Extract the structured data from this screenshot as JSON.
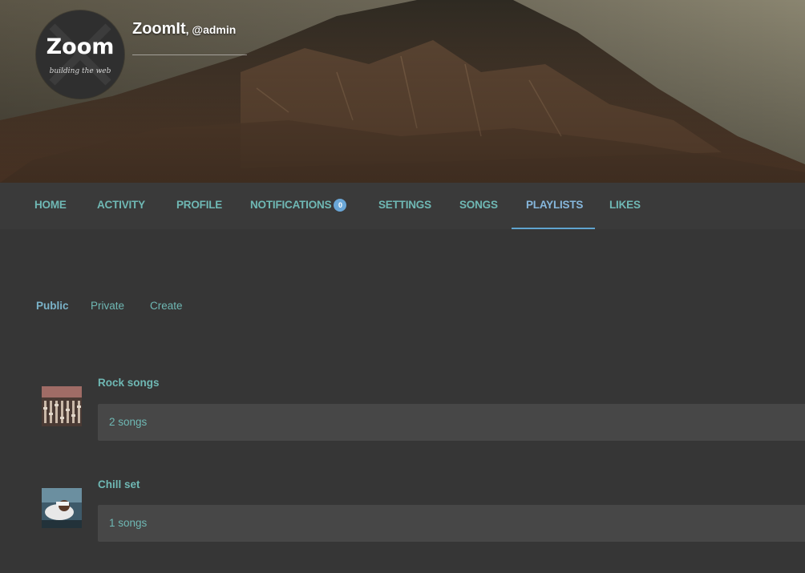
{
  "profile": {
    "display_name": "ZoomIt",
    "username": ", @admin",
    "avatar_logo": "Zoom",
    "avatar_tagline": "building the web"
  },
  "nav": {
    "items": [
      {
        "label": "HOME"
      },
      {
        "label": "ACTIVITY"
      },
      {
        "label": "PROFILE"
      },
      {
        "label": "NOTIFICATIONS",
        "badge": "0"
      },
      {
        "label": "SETTINGS"
      },
      {
        "label": "SONGS"
      },
      {
        "label": "PLAYLISTS",
        "active": true
      },
      {
        "label": "LIKES"
      }
    ]
  },
  "subtabs": [
    {
      "label": "Public",
      "active": true
    },
    {
      "label": "Private"
    },
    {
      "label": "Create"
    }
  ],
  "playlists": [
    {
      "title": "Rock songs",
      "count": "2 songs",
      "thumb_icon": "mixing-console-image"
    },
    {
      "title": "Chill set",
      "count": "1 songs",
      "thumb_icon": "person-relaxing-image"
    }
  ],
  "colors": {
    "link": "#6fb8b4",
    "active_link": "#86b7dc",
    "badge": "#6aa7d8",
    "background": "#363636",
    "bar": "#474747"
  }
}
